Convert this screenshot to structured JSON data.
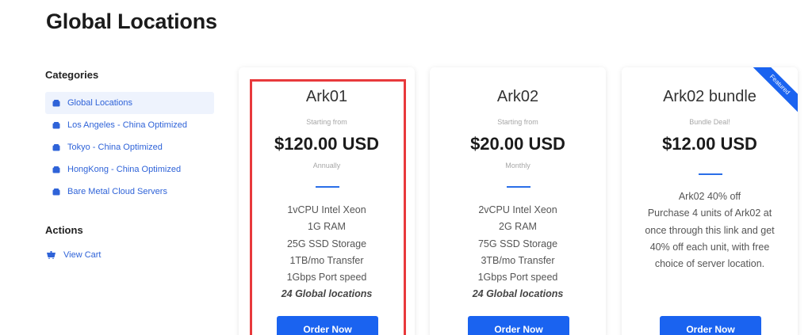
{
  "page": {
    "title": "Global Locations"
  },
  "sidebar": {
    "categories_heading": "Categories",
    "categories": [
      {
        "label": "Global Locations",
        "active": true
      },
      {
        "label": "Los Angeles - China Optimized",
        "active": false
      },
      {
        "label": "Tokyo - China Optimized",
        "active": false
      },
      {
        "label": "HongKong - China Optimized",
        "active": false
      },
      {
        "label": "Bare Metal Cloud Servers",
        "active": false
      }
    ],
    "actions_heading": "Actions",
    "actions": [
      {
        "label": "View Cart",
        "icon": "cart-icon"
      }
    ]
  },
  "products": [
    {
      "name": "Ark01",
      "subtext": "Starting from",
      "price": "$120.00 USD",
      "cycle": "Annually",
      "features": [
        "1vCPU Intel Xeon",
        "1G RAM",
        "25G SSD Storage",
        "1TB/mo Transfer",
        "1Gbps Port speed"
      ],
      "locations": "24 Global locations",
      "button": "Order Now"
    },
    {
      "name": "Ark02",
      "subtext": "Starting from",
      "price": "$20.00 USD",
      "cycle": "Monthly",
      "features": [
        "2vCPU Intel Xeon",
        "2G RAM",
        "75G SSD Storage",
        "3TB/mo Transfer",
        "1Gbps Port speed"
      ],
      "locations": "24 Global locations",
      "button": "Order Now"
    },
    {
      "name": "Ark02 bundle",
      "subtext": "Bundle Deal!",
      "price": "$12.00 USD",
      "description": [
        "Ark02 40% off",
        "Purchase 4 units of Ark02 at",
        "once through this link and get",
        "40% off each unit, with free",
        "choice of server location."
      ],
      "ribbon": "Featured",
      "button": "Order Now"
    }
  ],
  "colors": {
    "accent": "#1a63f0",
    "link": "#2f63d8",
    "highlight": "#e8393c"
  }
}
